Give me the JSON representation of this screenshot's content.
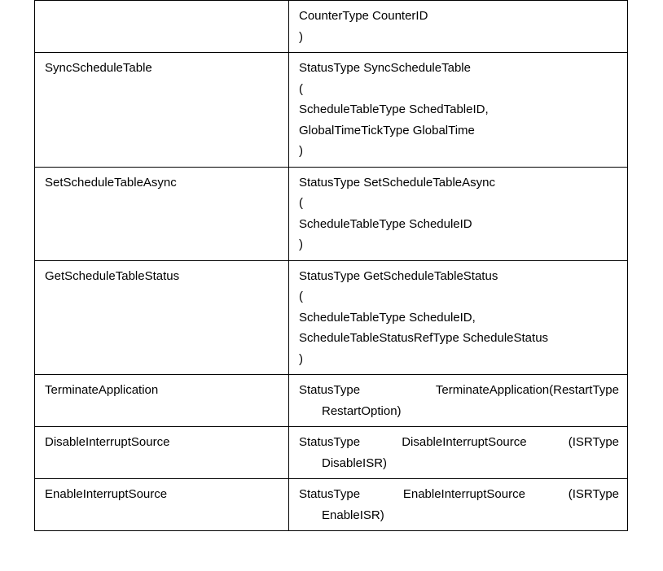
{
  "rows": [
    {
      "name": "",
      "sig": {
        "lines": [
          {
            "t": "plain",
            "v": "CounterType CounterID"
          },
          {
            "t": "plain",
            "v": ")"
          }
        ]
      }
    },
    {
      "name": "SyncScheduleTable",
      "sig": {
        "lines": [
          {
            "t": "plain",
            "v": "StatusType SyncScheduleTable"
          },
          {
            "t": "plain",
            "v": "("
          },
          {
            "t": "plain",
            "v": "ScheduleTableType SchedTableID,"
          },
          {
            "t": "plain",
            "v": "GlobalTimeTickType GlobalTime"
          },
          {
            "t": "plain",
            "v": ")"
          }
        ]
      }
    },
    {
      "name": "SetScheduleTableAsync",
      "sig": {
        "lines": [
          {
            "t": "plain",
            "v": "StatusType SetScheduleTableAsync"
          },
          {
            "t": "plain",
            "v": "("
          },
          {
            "t": "plain",
            "v": "ScheduleTableType ScheduleID"
          },
          {
            "t": "plain",
            "v": ")"
          }
        ]
      }
    },
    {
      "name": "GetScheduleTableStatus",
      "sig": {
        "lines": [
          {
            "t": "plain",
            "v": "StatusType GetScheduleTableStatus"
          },
          {
            "t": "plain",
            "v": "("
          },
          {
            "t": "plain",
            "v": "ScheduleTableType ScheduleID,"
          },
          {
            "t": "plain",
            "v": "ScheduleTableStatusRefType ScheduleStatus"
          },
          {
            "t": "plain",
            "v": ")"
          }
        ]
      }
    },
    {
      "name": "TerminateApplication",
      "sig": {
        "lines": [
          {
            "t": "justify",
            "parts": [
              "StatusType",
              "TerminateApplication(RestartType"
            ]
          },
          {
            "t": "indent",
            "v": "RestartOption)"
          }
        ]
      }
    },
    {
      "name": "DisableInterruptSource",
      "sig": {
        "lines": [
          {
            "t": "justify",
            "parts": [
              "StatusType",
              "DisableInterruptSource",
              "(ISRType"
            ]
          },
          {
            "t": "indent",
            "v": "DisableISR)"
          }
        ]
      }
    },
    {
      "name": "EnableInterruptSource",
      "sig": {
        "lines": [
          {
            "t": "justify",
            "parts": [
              "StatusType",
              "EnableInterruptSource",
              "(ISRType"
            ]
          },
          {
            "t": "indent",
            "v": "EnableISR)"
          }
        ]
      }
    }
  ]
}
